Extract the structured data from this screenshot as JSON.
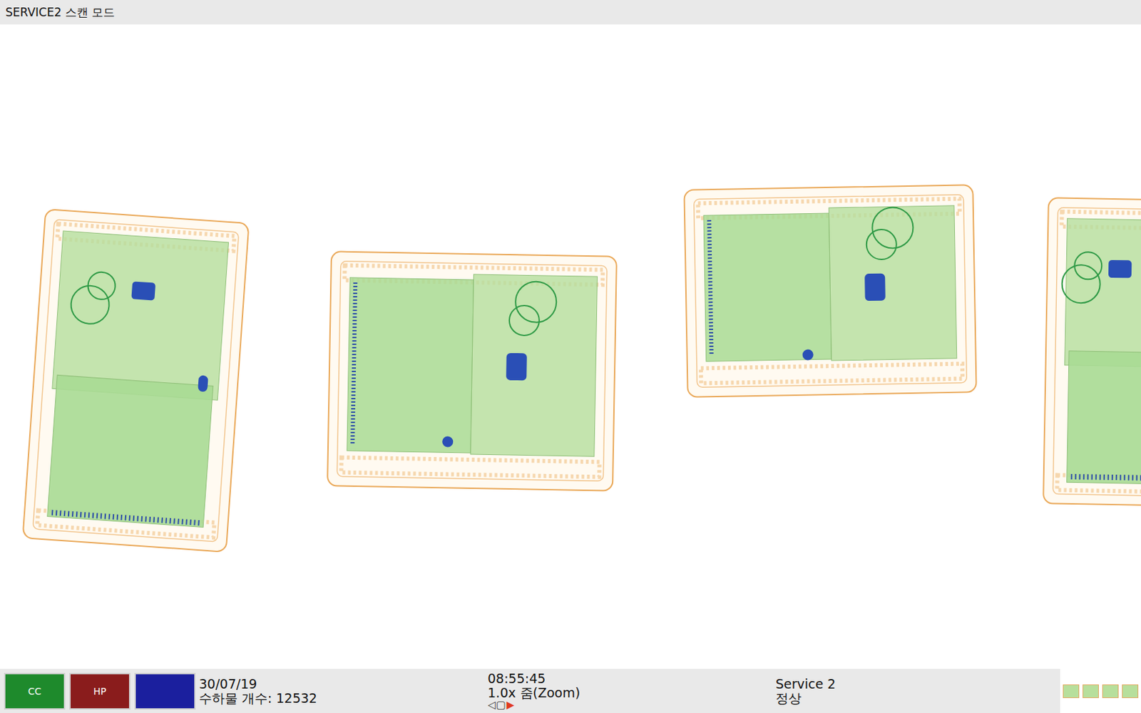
{
  "window": {
    "title": "SERVICE2 스캔 모드"
  },
  "buttons": [
    {
      "label": "CC",
      "color": "#1e8a2c"
    },
    {
      "label": "HP",
      "color": "#8a1c1c"
    },
    {
      "label": "",
      "color": "#1b1f9e"
    }
  ],
  "status": {
    "date": "30/07/19",
    "baggage_count": "수하물 개수: 12532",
    "time": "08:55:45",
    "zoom": "1.0x 줌(Zoom)",
    "service": "Service 2",
    "state": "정상"
  },
  "nav": [
    {
      "icon": "◁",
      "selected": false
    },
    {
      "icon": "▢",
      "selected": false
    },
    {
      "icon": "▶",
      "selected": true
    }
  ]
}
